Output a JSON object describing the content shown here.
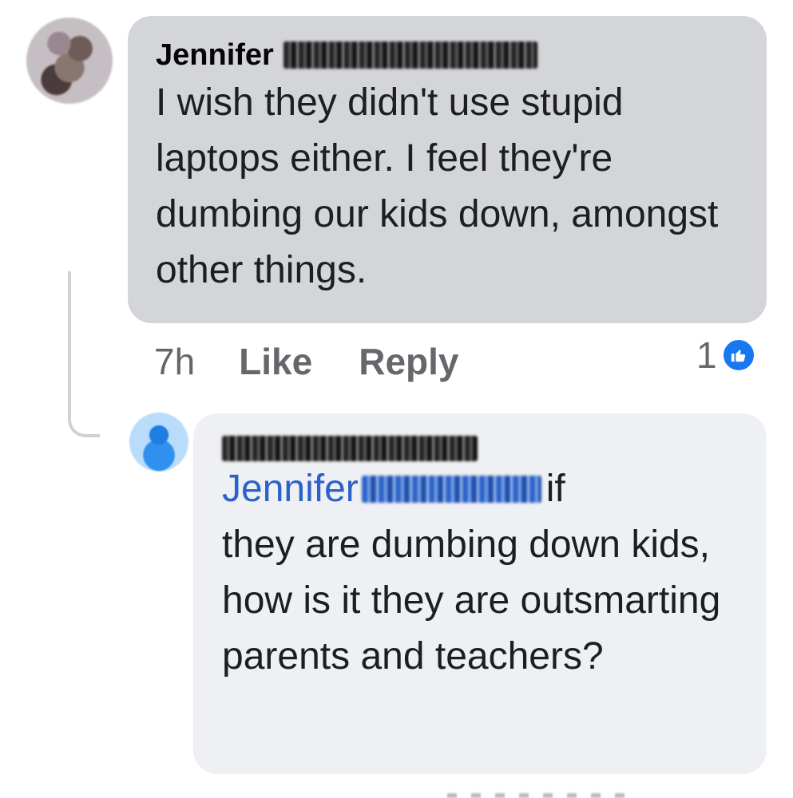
{
  "comment": {
    "author_first_name": "Jennifer",
    "text": "I wish they didn't use stupid laptops either. I feel they're dumbing our kids down, amongst other things.",
    "time": "7h",
    "like_label": "Like",
    "reply_label": "Reply",
    "reaction_count": "1"
  },
  "reply": {
    "mention_first_name": "Jennifer",
    "text_after_mention": "if",
    "text_body": "they are dumbing down kids, how is it they are outsmarting parents and teachers?"
  },
  "colors": {
    "bubble_primary": "#d4d5d9",
    "bubble_reply": "#eef0f3",
    "mention_blue": "#2a62c9",
    "like_badge_blue": "#1877f2",
    "meta_gray": "#65676b"
  },
  "icons": {
    "reaction": "thumbs-up-icon"
  }
}
